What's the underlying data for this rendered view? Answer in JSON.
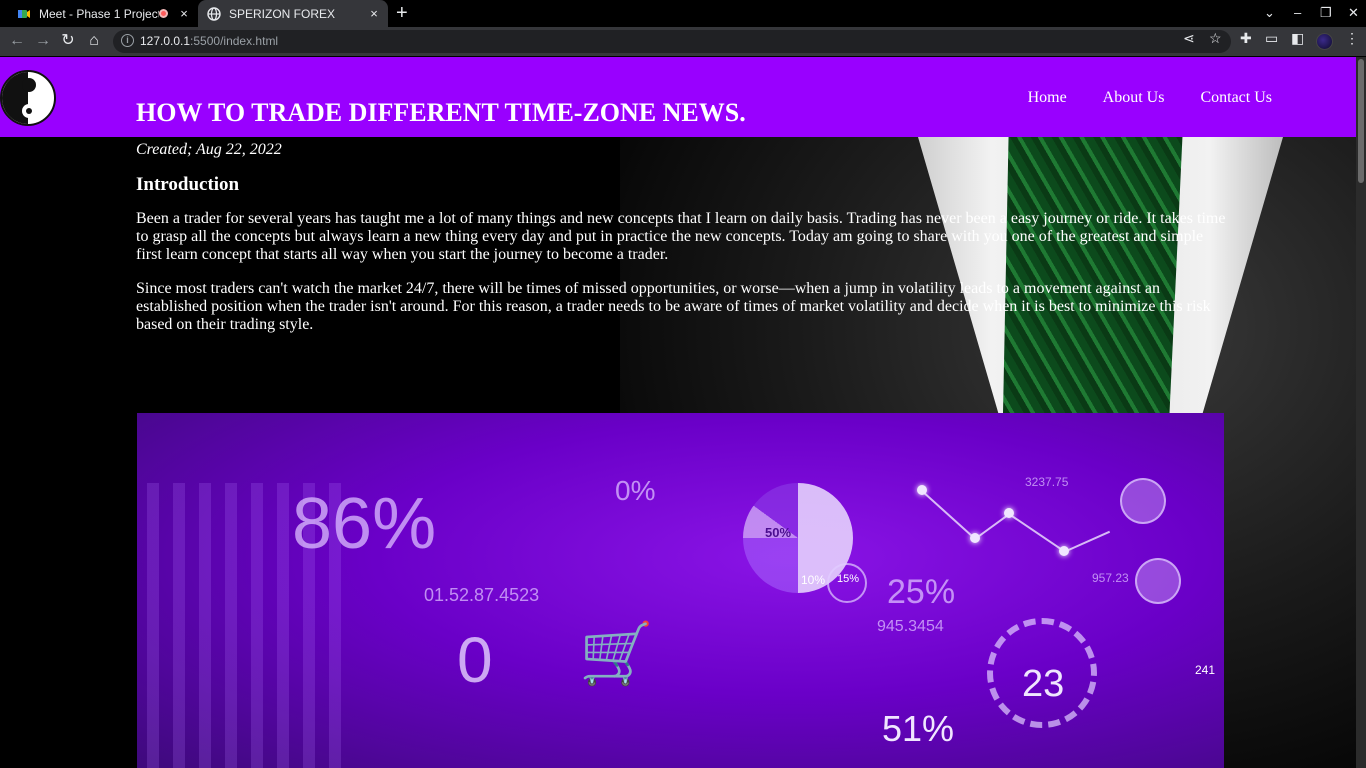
{
  "browser": {
    "tabs": [
      {
        "title": "Meet - Phase 1 Project Pre",
        "active": false
      },
      {
        "title": "SPERIZON FOREX",
        "active": true
      }
    ],
    "new_tab": "+",
    "close": "×",
    "url_host": "127.0.0.1",
    "url_rest": ":5500/index.html"
  },
  "nav": {
    "links": [
      "Home",
      "About Us",
      "Contact Us"
    ]
  },
  "article": {
    "title": "HOW TO TRADE DIFFERENT TIME-ZONE NEWS.",
    "created": "Created; Aug 22, 2022",
    "section": "Introduction",
    "paragraphs": [
      "Been a trader for several years has taught me a lot of many things and new concepts that I learn on daily basis. Trading has never been a easy journey or ride. It takes time to grasp all the concepts but always learn a new thing every day and put in practice the new concepts. Today am going to share with you one of the greatest and simple first learn concept that starts all way when you start the journey to become a trader.",
      "Since most traders can't watch the market 24/7, there will be times of missed opportunities, or worse—when a jump in volatility leads to a movement against an established position when the trader isn't around. For this reason, a trader needs to be aware of times of market volatility and decide when it is best to minimize this risk based on their trading style."
    ]
  },
  "hero_image": {
    "overlay_numbers": [
      "86%",
      "0%",
      "50%",
      "10%",
      "15%",
      "25%",
      "23",
      "51%",
      "241",
      "3237.75",
      "957.23",
      "945.3454",
      "01.52.87.4523"
    ]
  },
  "colors": {
    "nav_bg": "#9900ff",
    "tab_active_bg": "#35363a"
  }
}
